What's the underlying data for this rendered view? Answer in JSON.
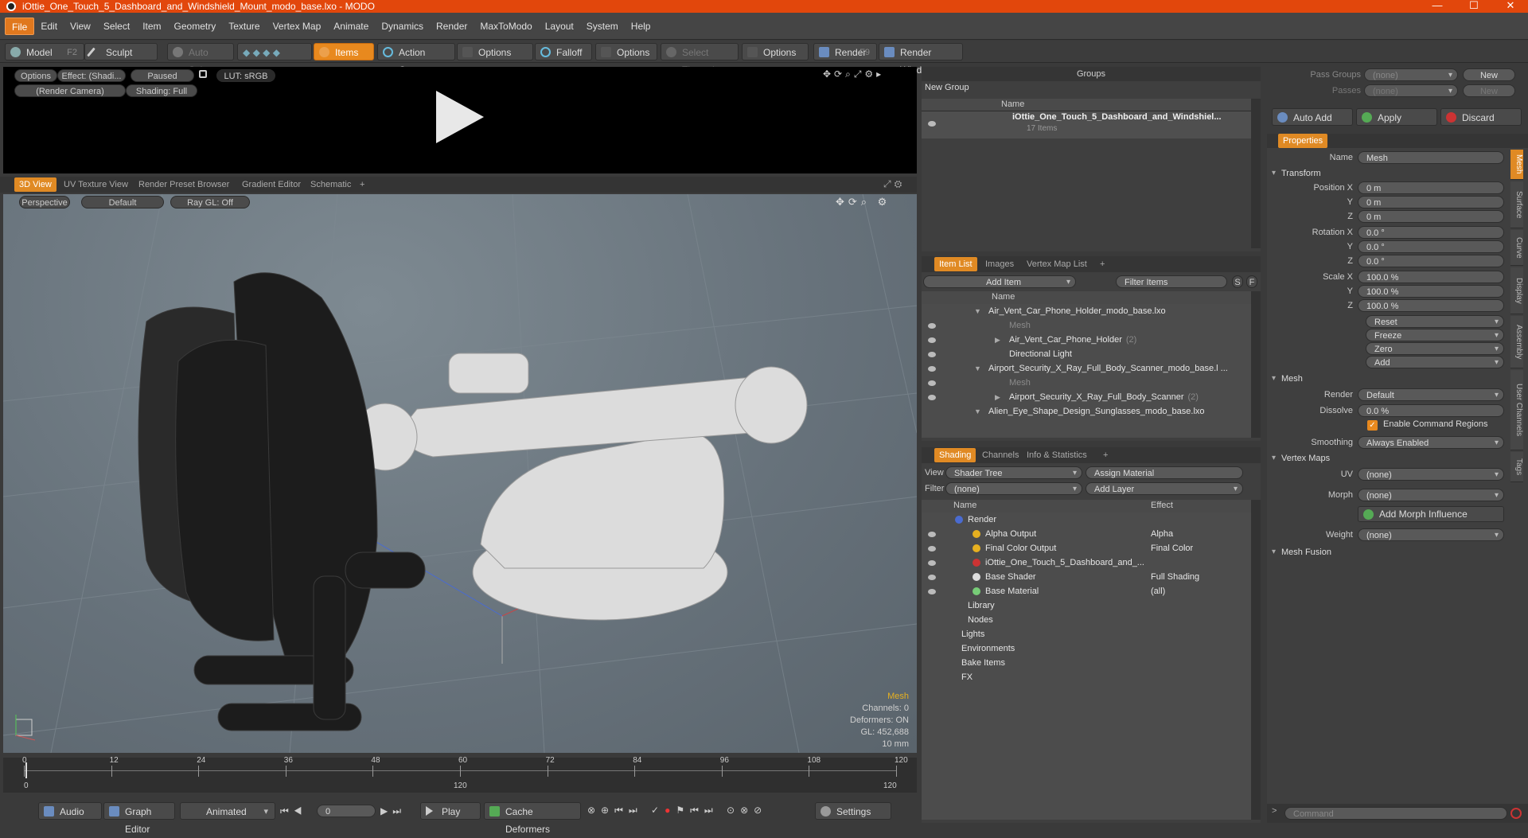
{
  "window": {
    "title": "iOttie_One_Touch_5_Dashboard_and_Windshield_Mount_modo_base.lxo - MODO",
    "minimize": "—",
    "maximize": "☐",
    "close": "✕"
  },
  "menu": [
    "File",
    "Edit",
    "View",
    "Select",
    "Item",
    "Geometry",
    "Texture",
    "Vertex Map",
    "Animate",
    "Dynamics",
    "Render",
    "MaxToModo",
    "Layout",
    "System",
    "Help"
  ],
  "toolbar": {
    "model": "Model",
    "model_key": "F2",
    "sculpt": "Sculpt",
    "auto_select": "Auto Select",
    "items": "Items",
    "action_center": "Action Center",
    "options1": "Options",
    "falloff": "Falloff",
    "options2": "Options",
    "select_through": "Select Through",
    "options3": "Options",
    "render": "Render",
    "render_key": "F9",
    "render_window": "Render Window"
  },
  "preview": {
    "options": "Options",
    "effect": "Effect: (Shadi...",
    "paused": "Paused",
    "lut": "LUT: sRGB",
    "camera": "(Render Camera)",
    "shading": "Shading: Full"
  },
  "viewport_tabs": [
    "3D View",
    "UV Texture View",
    "Render Preset Browser",
    "Gradient Editor",
    "Schematic",
    "+"
  ],
  "viewport_opts": {
    "perspective": "Perspective",
    "default": "Default",
    "raygl": "Ray GL: Off"
  },
  "viewport_info": {
    "type": "Mesh",
    "channels": "Channels: 0",
    "deformers": "Deformers: ON",
    "gl": "GL: 452,688",
    "size": "10 mm"
  },
  "groups": {
    "title": "Groups",
    "new_group": "New Group",
    "col_name": "Name",
    "item_name": "iOttie_One_Touch_5_Dashboard_and_Windshiel...",
    "item_count": "17 Items"
  },
  "itemlist": {
    "tabs": [
      "Item List",
      "Images",
      "Vertex Map List",
      "+"
    ],
    "add_item": "Add Item",
    "filter": "Filter Items",
    "s": "S",
    "f": "F",
    "col_name": "Name",
    "rows": [
      "Air_Vent_Car_Phone_Holder_modo_base.lxo",
      "Mesh",
      "Air_Vent_Car_Phone_Holder",
      "Directional Light",
      "Airport_Security_X_Ray_Full_Body_Scanner_modo_base.l ...",
      "Mesh",
      "Airport_Security_X_Ray_Full_Body_Scanner",
      "Alien_Eye_Shape_Design_Sunglasses_modo_base.lxo"
    ],
    "count2": "(2)"
  },
  "shading": {
    "tabs": [
      "Shading",
      "Channels",
      "Info & Statistics",
      "+"
    ],
    "view_lbl": "View",
    "view_val": "Shader Tree",
    "assign": "Assign Material",
    "filter_lbl": "Filter",
    "filter_val": "(none)",
    "add_layer": "Add Layer",
    "col_name": "Name",
    "col_effect": "Effect",
    "rows": [
      {
        "name": "Render",
        "effect": ""
      },
      {
        "name": "Alpha Output",
        "effect": "Alpha"
      },
      {
        "name": "Final Color Output",
        "effect": "Final Color"
      },
      {
        "name": "iOttie_One_Touch_5_Dashboard_and_...",
        "effect": ""
      },
      {
        "name": "Base Shader",
        "effect": "Full Shading"
      },
      {
        "name": "Base Material",
        "effect": "(all)"
      },
      {
        "name": "Library",
        "effect": ""
      },
      {
        "name": "Nodes",
        "effect": ""
      },
      {
        "name": "Lights",
        "effect": ""
      },
      {
        "name": "Environments",
        "effect": ""
      },
      {
        "name": "Bake Items",
        "effect": ""
      },
      {
        "name": "FX",
        "effect": ""
      }
    ]
  },
  "passes": {
    "pass_groups": "Pass Groups",
    "passes": "Passes",
    "none": "(none)",
    "new": "New",
    "auto_add": "Auto Add",
    "apply": "Apply",
    "discard": "Discard"
  },
  "properties": {
    "tab": "Properties",
    "name_lbl": "Name",
    "name_val": "Mesh",
    "transform": "Transform",
    "posx": "Position X",
    "y": "Y",
    "z": "Z",
    "rotx": "Rotation X",
    "scalex": "Scale X",
    "pos": [
      "0 m",
      "0 m",
      "0 m"
    ],
    "rot": [
      "0.0 °",
      "0.0 °",
      "0.0 °"
    ],
    "scale": [
      "100.0 %",
      "100.0 %",
      "100.0 %"
    ],
    "reset": "Reset",
    "freeze": "Freeze",
    "zero": "Zero",
    "add": "Add",
    "mesh": "Mesh",
    "render_lbl": "Render",
    "render_val": "Default",
    "dissolve_lbl": "Dissolve",
    "dissolve_val": "0.0 %",
    "ecr": "Enable Command Regions",
    "smoothing_lbl": "Smoothing",
    "smoothing_val": "Always Enabled",
    "vertex_maps": "Vertex Maps",
    "uv_lbl": "UV",
    "uv_val": "(none)",
    "morph_lbl": "Morph",
    "morph_val": "(none)",
    "add_morph": "Add Morph Influence",
    "weight_lbl": "Weight",
    "weight_val": "(none)",
    "mesh_fusion": "Mesh Fusion",
    "side_tabs": [
      "Mesh",
      "Surface",
      "Curve",
      "Display",
      "Assembly",
      "User Channels",
      "Tags"
    ]
  },
  "timeline": {
    "ticks": [
      "0",
      "12",
      "24",
      "36",
      "48",
      "60",
      "72",
      "84",
      "96",
      "108",
      "120"
    ],
    "start": "0",
    "mid": "120",
    "end": "120"
  },
  "bottom": {
    "audio": "Audio",
    "graph_editor": "Graph Editor",
    "animated": "Animated",
    "frame": "0",
    "play": "Play",
    "cache": "Cache Deformers",
    "settings": "Settings",
    "command": "Command"
  }
}
